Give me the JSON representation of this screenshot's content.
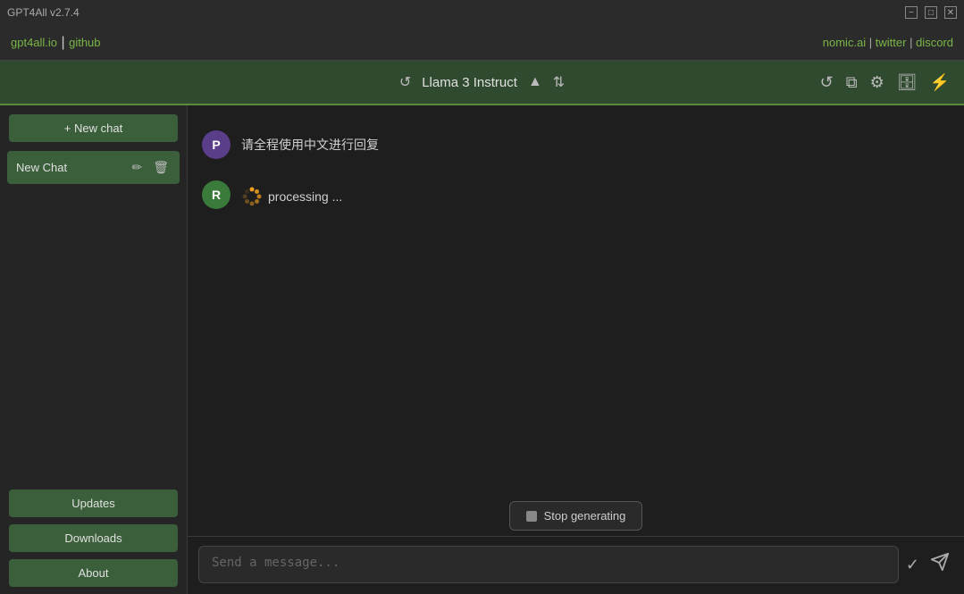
{
  "titlebar": {
    "title": "GPT4All v2.7.4",
    "minimize": "−",
    "maximize": "□",
    "close": "✕"
  },
  "navbar": {
    "left": {
      "link1": "gpt4all.io",
      "separator1": " | ",
      "link2": "github"
    },
    "right": {
      "link1": "nomic.ai",
      "sep1": " | ",
      "link2": "twitter",
      "sep2": " | ",
      "link3": "discord"
    }
  },
  "model_bar": {
    "model_name": "Llama 3 Instruct",
    "icon_refresh": "↺",
    "icon_upload": "▲",
    "icon_expand": "⇅"
  },
  "toolbar": {
    "icon_sync": "↺",
    "icon_copy": "⧉",
    "icon_settings": "⚙",
    "icon_db": "🗄",
    "icon_wifi": "⚡"
  },
  "sidebar": {
    "new_chat_label": "+ New chat",
    "chat_item_label": "New Chat",
    "edit_icon": "✏",
    "delete_icon": "🗑",
    "updates_label": "Updates",
    "downloads_label": "Downloads",
    "about_label": "About"
  },
  "chat": {
    "messages": [
      {
        "avatar": "P",
        "text": "请全程使用中文进行回复",
        "type": "user"
      },
      {
        "avatar": "R",
        "text": "processing ...",
        "type": "assistant",
        "loading": true
      }
    ]
  },
  "stop_btn": {
    "label": "Stop generating"
  },
  "input": {
    "placeholder": "Send a message..."
  }
}
